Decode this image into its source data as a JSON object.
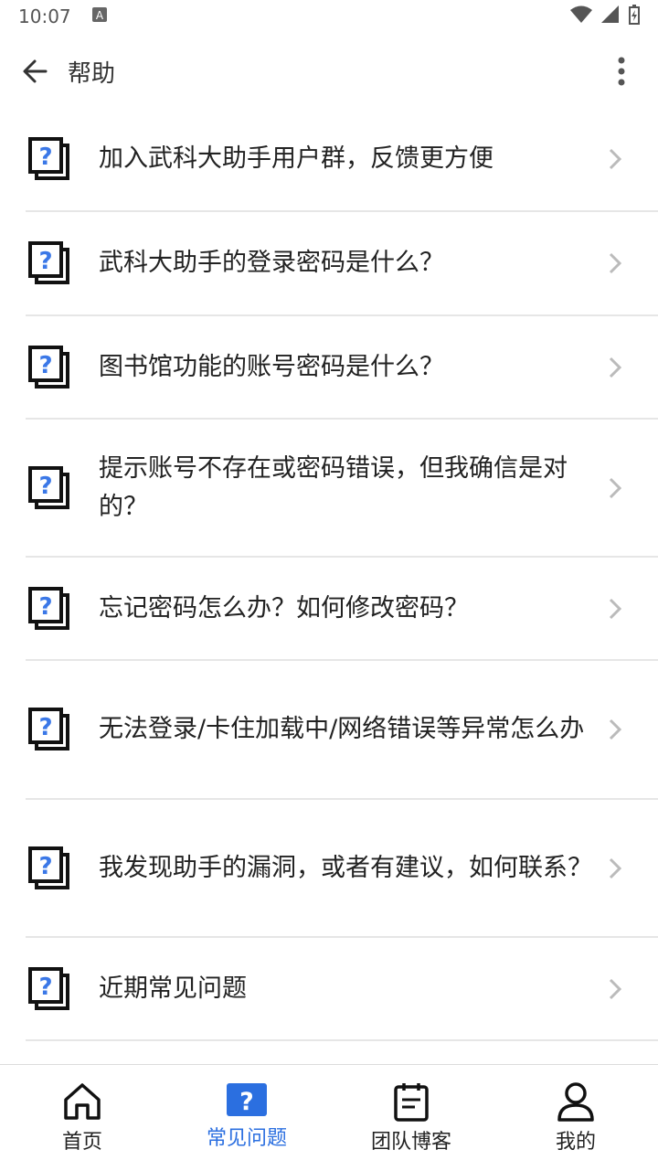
{
  "status_bar": {
    "time": "10:07"
  },
  "app_bar": {
    "title": "帮助"
  },
  "faq": [
    {
      "label": "加入武科大助手用户群，反馈更方便"
    },
    {
      "label": "武科大助手的登录密码是什么？"
    },
    {
      "label": "图书馆功能的账号密码是什么？"
    },
    {
      "label": "提示账号不存在或密码错误，但我确信是对的？"
    },
    {
      "label": "忘记密码怎么办？如何修改密码？"
    },
    {
      "label": "无法登录/卡住加载中/网络错误等异常怎么办"
    },
    {
      "label": "我发现助手的漏洞，或者有建议，如何联系？"
    },
    {
      "label": "近期常见问题"
    }
  ],
  "bottom_nav": [
    {
      "label": "首页",
      "icon": "home-icon"
    },
    {
      "label": "常见问题",
      "icon": "question-icon",
      "active": true
    },
    {
      "label": "团队博客",
      "icon": "blog-icon"
    },
    {
      "label": "我的",
      "icon": "person-icon"
    }
  ],
  "colors": {
    "accent": "#2b6fe0",
    "divider": "#e6e6e6"
  }
}
